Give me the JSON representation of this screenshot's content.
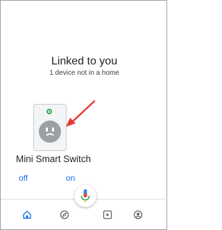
{
  "header": {
    "title": "Linked to you",
    "subtitle": "1 device not in a home"
  },
  "device": {
    "name": "Mini Smart Switch",
    "icon": "outlet-icon",
    "status_color": "#34a853",
    "off_label": "off",
    "on_label": "on"
  },
  "bottom_nav": {
    "items": [
      {
        "icon": "home-icon",
        "active": true
      },
      {
        "icon": "compass-icon",
        "active": false
      },
      {
        "icon": "media-icon",
        "active": false
      },
      {
        "icon": "account-icon",
        "active": false
      }
    ],
    "assistant_icon": "mic-icon"
  },
  "colors": {
    "accent": "#1a73e8",
    "annotation": "#e53935",
    "text": "#202124"
  }
}
